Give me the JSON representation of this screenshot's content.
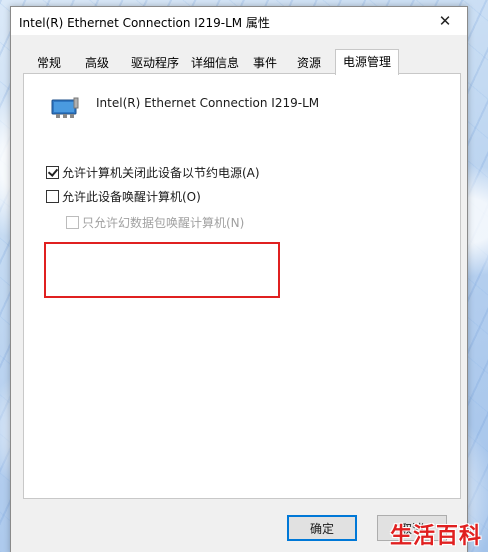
{
  "window": {
    "title": "Intel(R) Ethernet Connection I219-LM 属性",
    "close_glyph": "✕"
  },
  "tabs": [
    {
      "label": "常规",
      "active": false
    },
    {
      "label": "高级",
      "active": false
    },
    {
      "label": "驱动程序",
      "active": false
    },
    {
      "label": "详细信息",
      "active": false
    },
    {
      "label": "事件",
      "active": false
    },
    {
      "label": "资源",
      "active": false
    },
    {
      "label": "电源管理",
      "active": true
    }
  ],
  "device": {
    "icon": "network-adapter-icon",
    "name": "Intel(R) Ethernet Connection I219-LM"
  },
  "options": {
    "allow_power_off": {
      "label": "允许计算机关闭此设备以节约电源(A)",
      "checked": true,
      "enabled": true
    },
    "allow_wake": {
      "label": "允许此设备唤醒计算机(O)",
      "checked": false,
      "enabled": true
    },
    "magic_packet_only": {
      "label": "只允许幻数据包唤醒计算机(N)",
      "checked": false,
      "enabled": false
    }
  },
  "buttons": {
    "ok": "确定",
    "cancel": "取消"
  },
  "watermark": "生活百科",
  "colors": {
    "highlight_border": "#e02020",
    "accent": "#0078d7",
    "watermark": "#e02020"
  }
}
